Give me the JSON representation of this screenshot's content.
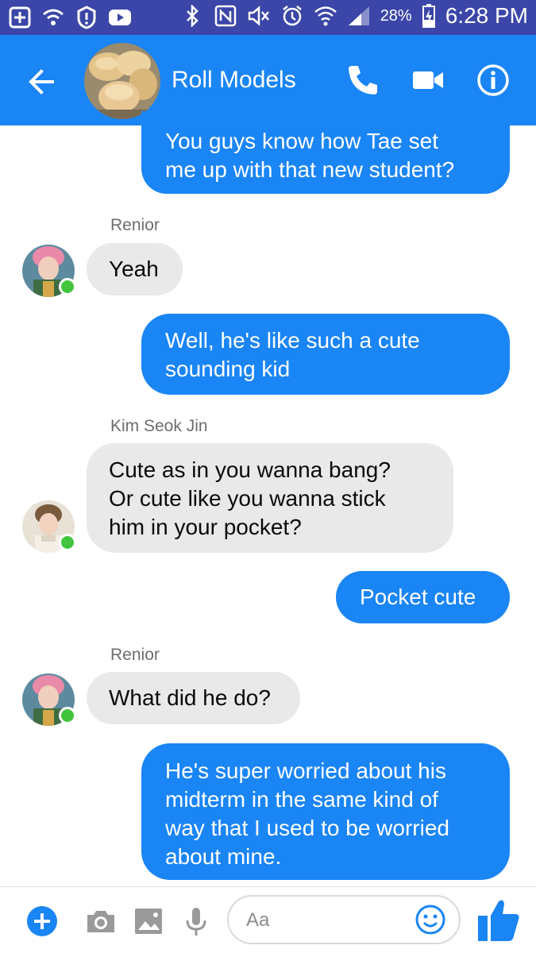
{
  "status_bar": {
    "battery": "28%",
    "time": "6:28 PM"
  },
  "header": {
    "title": "Roll Models",
    "icons": [
      "back-arrow-icon",
      "phone-icon",
      "video-camera-icon",
      "info-icon"
    ]
  },
  "messages": [
    {
      "direction": "outgoing",
      "lines": [
        "You guys know how Tae set",
        "me up with that new student?"
      ]
    },
    {
      "direction": "incoming",
      "sender": "Renior",
      "lines": [
        "Yeah"
      ]
    },
    {
      "direction": "outgoing",
      "lines": [
        "Well, he's like such a cute",
        "sounding kid"
      ]
    },
    {
      "direction": "incoming",
      "sender": "Kim Seok Jin",
      "lines": [
        "Cute as in you wanna bang?",
        "Or cute like you wanna stick",
        "him in your pocket?"
      ]
    },
    {
      "direction": "outgoing",
      "lines": [
        "Pocket cute"
      ]
    },
    {
      "direction": "incoming",
      "sender": "Renior",
      "lines": [
        "What did he do?"
      ]
    },
    {
      "direction": "outgoing",
      "lines": [
        "He's super worried about his",
        "midterm in the same kind of",
        "way that I used to be worried",
        "about mine."
      ]
    }
  ],
  "composer": {
    "placeholder": "Aa",
    "icons": [
      "plus-icon",
      "camera-icon",
      "image-icon",
      "microphone-icon",
      "emoji-icon",
      "thumbs-up-icon"
    ]
  },
  "colors": {
    "status_bar": "#3b46a8",
    "header": "#1a85f5",
    "outgoing_bubble": "#1a85f5",
    "incoming_bubble": "#e9e9e9",
    "presence": "#42c53c"
  }
}
